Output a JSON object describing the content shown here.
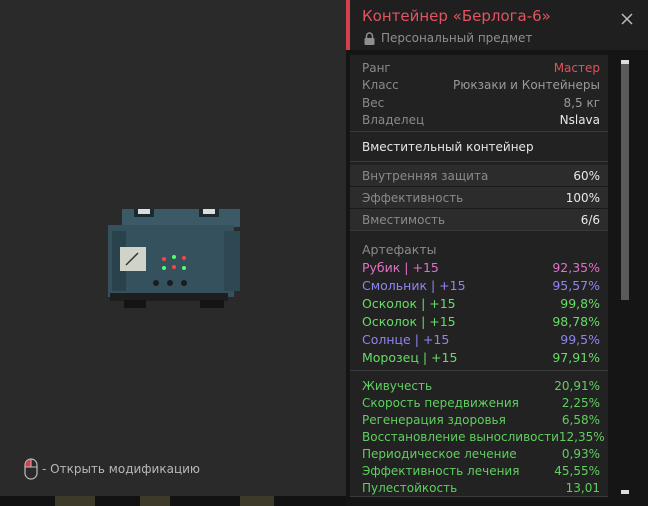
{
  "hint": {
    "text": "- Открыть модификацию",
    "icon": "mouse-icon"
  },
  "item": {
    "image": "container-image"
  },
  "panel": {
    "title": "Контейнер «Берлога-6»",
    "subtitle": "Персональный предмет",
    "close_icon": "close-icon",
    "lock_icon": "lock-icon"
  },
  "info": [
    {
      "label": "Ранг",
      "value": "Мастер"
    },
    {
      "label": "Класс",
      "value": "Рюкзаки и Контейнеры"
    },
    {
      "label": "Вес",
      "value": "8,5 кг"
    },
    {
      "label": "Владелец",
      "value": "Nslava"
    }
  ],
  "description": "Вместительный контейнер",
  "stats": [
    {
      "label": "Внутренняя защита",
      "value": "60%"
    },
    {
      "label": "Эффективность",
      "value": "100%"
    },
    {
      "label": "Вместимость",
      "value": "6/6"
    }
  ],
  "artifacts": {
    "heading": "Артефакты",
    "items": [
      {
        "name": "Рубик | +15",
        "value": "92,35%",
        "color": "#e070c8"
      },
      {
        "name": "Смольник | +15",
        "value": "95,57%",
        "color": "#8e86f0"
      },
      {
        "name": "Осколок | +15",
        "value": "99,8%",
        "color": "#66dd66"
      },
      {
        "name": "Осколок | +15",
        "value": "98,78%",
        "color": "#66dd66"
      },
      {
        "name": "Солнце | +15",
        "value": "99,5%",
        "color": "#8e86f0"
      },
      {
        "name": "Морозец | +15",
        "value": "97,91%",
        "color": "#66dd66"
      }
    ]
  },
  "effects": [
    {
      "label": "Живучесть",
      "value": "20,91%"
    },
    {
      "label": "Скорость передвижения",
      "value": "2,25%"
    },
    {
      "label": "Регенерация здоровья",
      "value": "6,58%"
    },
    {
      "label": "Восстановление выносливости",
      "value": "12,35%"
    },
    {
      "label": "Периодическое лечение",
      "value": "0,93%"
    },
    {
      "label": "Эффективность лечения",
      "value": "45,55%"
    },
    {
      "label": "Пулестойкость",
      "value": "13,01"
    }
  ],
  "colors": {
    "accent": "#d6404c",
    "rank": "#e3505c",
    "effect": "#5fcf5f"
  },
  "scroll": {
    "position": 0.0,
    "visible_fraction": 0.55
  }
}
